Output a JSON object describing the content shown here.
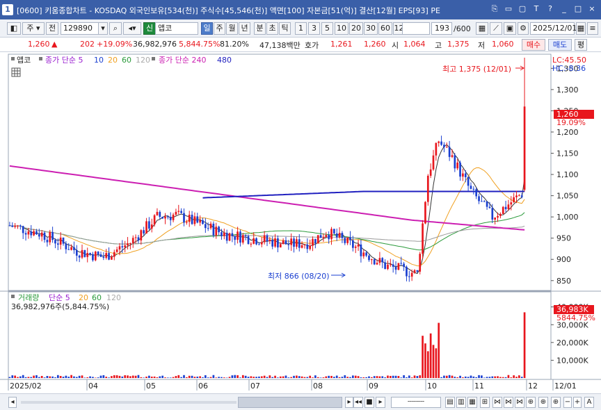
{
  "window": {
    "number": "1",
    "title": "[0600] 키움종합차트 - KOSDAQ 외국인보유[534(천)] 주식수[45,546(천)] 액면[100] 자본금[51(억)] 결산[12월] EPS[93] PE",
    "buttons": [
      "⎘",
      "▭",
      "▢",
      "T",
      "?",
      "_",
      "□",
      "×"
    ]
  },
  "toolbar": {
    "period_label": "주",
    "prev_label": "전",
    "code": "129890",
    "type_badge": "신",
    "name": "앱코",
    "tabs": [
      "일",
      "주",
      "월",
      "년",
      "분",
      "초",
      "틱"
    ],
    "active_tab": "일",
    "intervals": [
      "1",
      "3",
      "5",
      "10",
      "20",
      "30",
      "60",
      "120"
    ],
    "count": "193",
    "count_total": "/600",
    "date": "2025/12/01"
  },
  "quote": {
    "price": "1,260",
    "arrow": "▲",
    "change": "202",
    "change_pct": "+19.09%",
    "volume": "36,982,976",
    "volume_pct": "5,844.75%",
    "ratio": "81.20%",
    "amount": "47,138백만",
    "bid_label": "호가",
    "bid1": "1,261",
    "bid2": "1,260",
    "open_label": "시",
    "open": "1,064",
    "high_label": "고",
    "high": "1,375",
    "low_label": "저",
    "low": "1,060",
    "buy_label": "매수",
    "sell_label": "매도",
    "eval_label": "평"
  },
  "price_panel": {
    "legend_name": "앱코",
    "legend_ma1": "종가 단순 5",
    "legend_ma_periods": [
      "10",
      "20",
      "60",
      "120"
    ],
    "legend_ma2": "종가 단순 240",
    "legend_ma2_extra": "480",
    "lc": "LC:45.50",
    "hc": "HC:-8.36",
    "high_annotation": "최고 1,375 (12/01)",
    "low_annotation": "최저 866 (08/20)",
    "current_tag": "1,260",
    "current_pct": "19.09%"
  },
  "volume_panel": {
    "legend_name": "거래량",
    "legend_ma": "단순 5",
    "legend_periods": [
      "20",
      "60",
      "120"
    ],
    "value_label": "36,982,976주(5,844.75%)",
    "current_tag": "36,983K",
    "current_pct": "5844.75%"
  },
  "chart_data": {
    "type": "candlestick",
    "y_axis_ticks": [
      1350,
      1300,
      1250,
      1200,
      1150,
      1100,
      1050,
      1000,
      950,
      900,
      850
    ],
    "y_range": [
      830,
      1380
    ],
    "vol_ticks": [
      "40,000K",
      "30,000K",
      "20,000K",
      "10,000K"
    ],
    "vol_range": [
      0,
      43000
    ],
    "x_labels": [
      "2025/02",
      "04",
      "05",
      "06",
      "07",
      "08",
      "09",
      "10",
      "11",
      "12",
      "12/01"
    ],
    "n_bars": 193,
    "colors": {
      "up": "#e8161d",
      "down": "#1a3fd0",
      "ma5": "#333333",
      "ma20": "#f0a020",
      "ma60": "#2a9a3a",
      "ma120": "#9a9a9a",
      "ma240": "#cc1fb2",
      "ma480": "#1f1fbf"
    }
  }
}
